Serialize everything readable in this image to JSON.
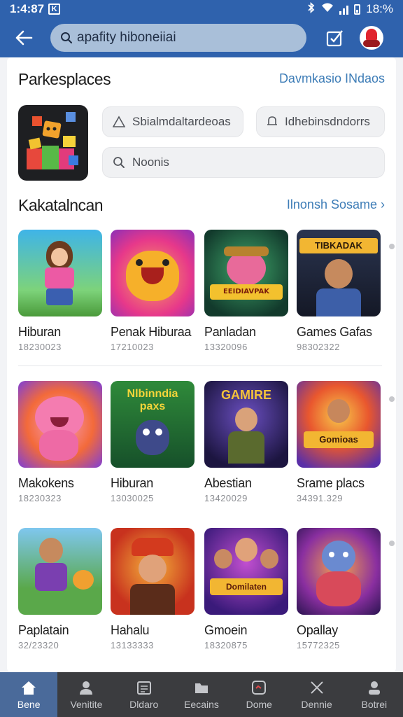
{
  "status_bar": {
    "time": "1:4:87",
    "notification_glyph": "K",
    "battery": "18:%"
  },
  "search": {
    "query": "apafity hiboneiiai"
  },
  "featured": {
    "title": "Parkesplaces",
    "link": "Davmkasio INdaos",
    "chips": [
      "Sbialmdaltardeoas",
      "Idhebinsdndorrs",
      "Noonis"
    ]
  },
  "games_section": {
    "title": "Kakatalncan",
    "link": "Ilnonsh Sosame",
    "rows": [
      [
        {
          "name": "Hiburan",
          "meta": "18230023"
        },
        {
          "name": "Penak Hiburaa",
          "meta": "17210023"
        },
        {
          "name": "Panladan",
          "meta": "13320096"
        },
        {
          "name": "Games Gafas",
          "meta": "98302322"
        }
      ],
      [
        {
          "name": "Makokens",
          "meta": "18230323"
        },
        {
          "name": "Hiburan",
          "meta": "13030025"
        },
        {
          "name": "Abestian",
          "meta": "13420029"
        },
        {
          "name": "Srame placs",
          "meta": "34391.329"
        }
      ],
      [
        {
          "name": "Paplatain",
          "meta": "32/23320"
        },
        {
          "name": "Hahalu",
          "meta": "13133333"
        },
        {
          "name": "Gmoein",
          "meta": "18320875"
        },
        {
          "name": "Opallay",
          "meta": "15772325"
        }
      ]
    ],
    "thumb_captions": [
      "TIBKADAK",
      "EEIDIAVPAK",
      "Nlbinndia paxs",
      "GAMIRE",
      "Gomioas",
      "Domilaten"
    ]
  },
  "bottom_nav": [
    {
      "label": "Bene",
      "icon": "home-icon",
      "active": true
    },
    {
      "label": "Venitite",
      "icon": "person-icon",
      "active": false
    },
    {
      "label": "Dldaro",
      "icon": "calendar-icon",
      "active": false
    },
    {
      "label": "Eecains",
      "icon": "folder-icon",
      "active": false
    },
    {
      "label": "Dome",
      "icon": "message-icon",
      "active": false
    },
    {
      "label": "Dennie",
      "icon": "share-icon",
      "active": false
    },
    {
      "label": "Botrei",
      "icon": "profile-icon",
      "active": false
    }
  ],
  "colors": {
    "brand": "#2f62ad",
    "link": "#3e7db7",
    "nav_bg": "#3b3c3f",
    "nav_active": "#4a6a9a"
  }
}
